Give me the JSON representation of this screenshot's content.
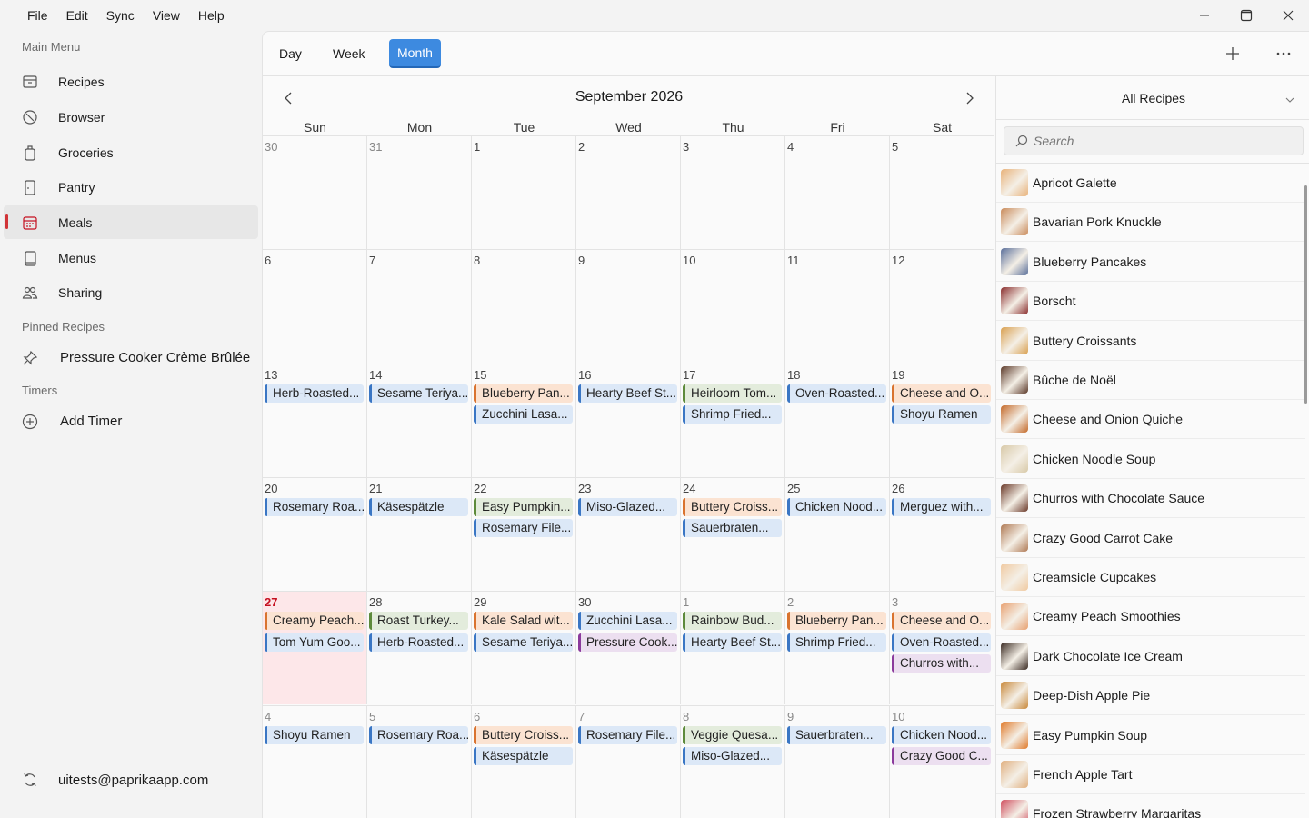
{
  "menubar": {
    "items": [
      "File",
      "Edit",
      "Sync",
      "View",
      "Help"
    ]
  },
  "sidebar": {
    "main_menu_title": "Main Menu",
    "items": [
      {
        "label": "Recipes",
        "icon": "recipes-box-icon"
      },
      {
        "label": "Browser",
        "icon": "compass-icon"
      },
      {
        "label": "Groceries",
        "icon": "grocery-bag-icon"
      },
      {
        "label": "Pantry",
        "icon": "pantry-door-icon"
      },
      {
        "label": "Meals",
        "icon": "calendar-icon",
        "active": true
      },
      {
        "label": "Menus",
        "icon": "menu-book-icon"
      },
      {
        "label": "Sharing",
        "icon": "people-icon"
      }
    ],
    "pinned_title": "Pinned Recipes",
    "pinned": [
      {
        "label": "Pressure Cooker Crème Brûlée",
        "icon": "pin-icon"
      }
    ],
    "timers_title": "Timers",
    "add_timer": "Add Timer",
    "account": "uitests@paprikaapp.com"
  },
  "toolbar": {
    "views": [
      "Day",
      "Week",
      "Month"
    ],
    "active_view": "Month"
  },
  "calendar": {
    "month_title": "September 2026",
    "weekdays": [
      "Sun",
      "Mon",
      "Tue",
      "Wed",
      "Thu",
      "Fri",
      "Sat"
    ],
    "weeks": [
      [
        {
          "d": "30",
          "m": true,
          "e": []
        },
        {
          "d": "31",
          "m": true,
          "e": []
        },
        {
          "d": "1",
          "e": []
        },
        {
          "d": "2",
          "e": []
        },
        {
          "d": "3",
          "e": []
        },
        {
          "d": "4",
          "e": []
        },
        {
          "d": "5",
          "e": []
        }
      ],
      [
        {
          "d": "6",
          "e": []
        },
        {
          "d": "7",
          "e": []
        },
        {
          "d": "8",
          "e": []
        },
        {
          "d": "9",
          "e": []
        },
        {
          "d": "10",
          "e": []
        },
        {
          "d": "11",
          "e": []
        },
        {
          "d": "12",
          "e": []
        }
      ],
      [
        {
          "d": "13",
          "e": [
            {
              "t": "Herb-Roasted...",
              "c": "blue"
            }
          ]
        },
        {
          "d": "14",
          "e": [
            {
              "t": "Sesame Teriya...",
              "c": "blue"
            }
          ]
        },
        {
          "d": "15",
          "e": [
            {
              "t": "Blueberry Pan...",
              "c": "orange"
            },
            {
              "t": "Zucchini Lasa...",
              "c": "blue"
            }
          ]
        },
        {
          "d": "16",
          "e": [
            {
              "t": "Hearty Beef St...",
              "c": "blue"
            }
          ]
        },
        {
          "d": "17",
          "e": [
            {
              "t": "Heirloom Tom...",
              "c": "green"
            },
            {
              "t": "Shrimp Fried...",
              "c": "blue"
            }
          ]
        },
        {
          "d": "18",
          "e": [
            {
              "t": "Oven-Roasted...",
              "c": "blue"
            }
          ]
        },
        {
          "d": "19",
          "e": [
            {
              "t": "Cheese and O...",
              "c": "orange"
            },
            {
              "t": "Shoyu Ramen",
              "c": "blue"
            }
          ]
        }
      ],
      [
        {
          "d": "20",
          "e": [
            {
              "t": "Rosemary Roa...",
              "c": "blue"
            }
          ]
        },
        {
          "d": "21",
          "e": [
            {
              "t": "Käsespätzle",
              "c": "blue"
            }
          ]
        },
        {
          "d": "22",
          "e": [
            {
              "t": "Easy Pumpkin...",
              "c": "green"
            },
            {
              "t": "Rosemary File...",
              "c": "blue"
            }
          ]
        },
        {
          "d": "23",
          "e": [
            {
              "t": "Miso-Glazed...",
              "c": "blue"
            }
          ]
        },
        {
          "d": "24",
          "e": [
            {
              "t": "Buttery Croiss...",
              "c": "orange"
            },
            {
              "t": "Sauerbraten...",
              "c": "blue"
            }
          ]
        },
        {
          "d": "25",
          "e": [
            {
              "t": "Chicken Nood...",
              "c": "blue"
            }
          ]
        },
        {
          "d": "26",
          "e": [
            {
              "t": "Merguez with...",
              "c": "blue"
            }
          ]
        }
      ],
      [
        {
          "d": "27",
          "today": true,
          "e": [
            {
              "t": "Creamy Peach...",
              "c": "orange"
            },
            {
              "t": "Tom Yum Goo...",
              "c": "blue"
            }
          ]
        },
        {
          "d": "28",
          "e": [
            {
              "t": "Roast Turkey...",
              "c": "green"
            },
            {
              "t": "Herb-Roasted...",
              "c": "blue"
            }
          ]
        },
        {
          "d": "29",
          "e": [
            {
              "t": "Kale Salad wit...",
              "c": "orange"
            },
            {
              "t": "Sesame Teriya...",
              "c": "blue"
            }
          ]
        },
        {
          "d": "30",
          "e": [
            {
              "t": "Zucchini Lasa...",
              "c": "blue"
            },
            {
              "t": "Pressure Cook...",
              "c": "purple"
            }
          ]
        },
        {
          "d": "1",
          "m": true,
          "e": [
            {
              "t": "Rainbow Bud...",
              "c": "green"
            },
            {
              "t": "Hearty Beef St...",
              "c": "blue"
            }
          ]
        },
        {
          "d": "2",
          "m": true,
          "e": [
            {
              "t": "Blueberry Pan...",
              "c": "orange"
            },
            {
              "t": "Shrimp Fried...",
              "c": "blue"
            }
          ]
        },
        {
          "d": "3",
          "m": true,
          "e": [
            {
              "t": "Cheese and O...",
              "c": "orange"
            },
            {
              "t": "Oven-Roasted...",
              "c": "blue"
            },
            {
              "t": "Churros with...",
              "c": "purple"
            }
          ]
        }
      ],
      [
        {
          "d": "4",
          "m": true,
          "e": [
            {
              "t": "Shoyu Ramen",
              "c": "blue"
            }
          ]
        },
        {
          "d": "5",
          "m": true,
          "e": [
            {
              "t": "Rosemary Roa...",
              "c": "blue"
            }
          ]
        },
        {
          "d": "6",
          "m": true,
          "e": [
            {
              "t": "Buttery Croiss...",
              "c": "orange"
            },
            {
              "t": "Käsespätzle",
              "c": "blue"
            }
          ]
        },
        {
          "d": "7",
          "m": true,
          "e": [
            {
              "t": "Rosemary File...",
              "c": "blue"
            }
          ]
        },
        {
          "d": "8",
          "m": true,
          "e": [
            {
              "t": "Veggie Quesa...",
              "c": "green"
            },
            {
              "t": "Miso-Glazed...",
              "c": "blue"
            }
          ]
        },
        {
          "d": "9",
          "m": true,
          "e": [
            {
              "t": "Sauerbraten...",
              "c": "blue"
            }
          ]
        },
        {
          "d": "10",
          "m": true,
          "e": [
            {
              "t": "Chicken Nood...",
              "c": "blue"
            },
            {
              "t": "Crazy Good C...",
              "c": "purple"
            }
          ]
        }
      ]
    ]
  },
  "recipes_panel": {
    "filter": "All Recipes",
    "search_placeholder": "Search",
    "items": [
      {
        "name": "Apricot Galette",
        "thumb": "#e8b27a"
      },
      {
        "name": "Bavarian Pork Knuckle",
        "thumb": "#c98a5a"
      },
      {
        "name": "Blueberry Pancakes",
        "thumb": "#5a6f9a"
      },
      {
        "name": "Borscht",
        "thumb": "#8a2e2e"
      },
      {
        "name": "Buttery Croissants",
        "thumb": "#d9a050"
      },
      {
        "name": "Bûche de Noël",
        "thumb": "#5c3a2a"
      },
      {
        "name": "Cheese and Onion Quiche",
        "thumb": "#c46a2a"
      },
      {
        "name": "Chicken Noodle Soup",
        "thumb": "#d8c9a8"
      },
      {
        "name": "Churros with Chocolate Sauce",
        "thumb": "#6b3a2a"
      },
      {
        "name": "Crazy Good Carrot Cake",
        "thumb": "#b07a55"
      },
      {
        "name": "Creamsicle Cupcakes",
        "thumb": "#f0c9a0"
      },
      {
        "name": "Creamy Peach Smoothies",
        "thumb": "#e8a070"
      },
      {
        "name": "Dark Chocolate Ice Cream",
        "thumb": "#3a2a22"
      },
      {
        "name": "Deep-Dish Apple Pie",
        "thumb": "#c8883a"
      },
      {
        "name": "Easy Pumpkin Soup",
        "thumb": "#e07a2a"
      },
      {
        "name": "French Apple Tart",
        "thumb": "#e0b080"
      },
      {
        "name": "Frozen Strawberry Margaritas",
        "thumb": "#d05060"
      }
    ]
  }
}
